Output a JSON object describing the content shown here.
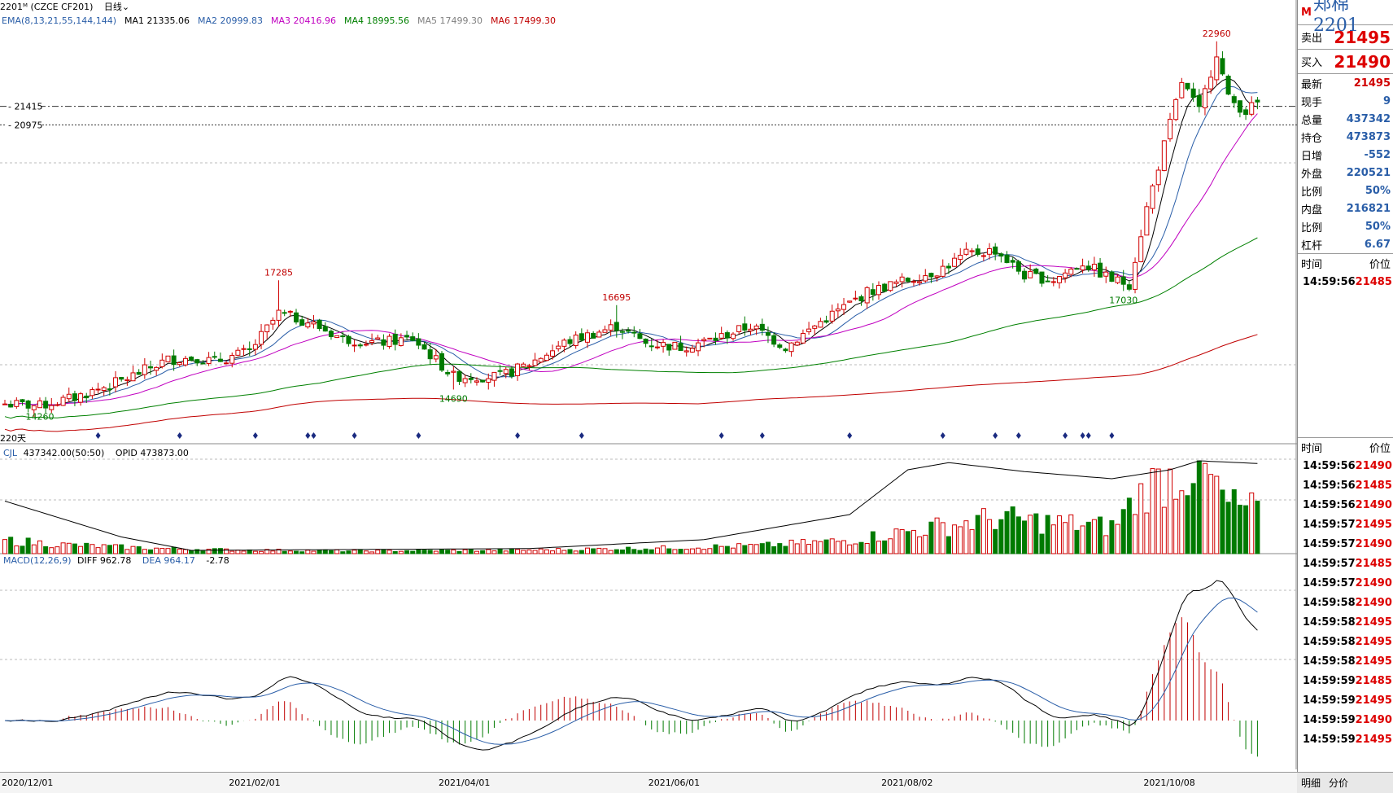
{
  "header": {
    "symbol_line": "2201ᴹ (CZCE CF201)",
    "period": "日线",
    "indicators": [
      {
        "label": "EMA(8,13,21,55,144,144)",
        "color": "#2a5ea8"
      },
      {
        "label": "MA1 21335.06",
        "color": "#000000"
      },
      {
        "label": "MA2 20999.83",
        "color": "#2a5ea8"
      },
      {
        "label": "MA3 20416.96",
        "color": "#c000c0"
      },
      {
        "label": "MA4 18995.56",
        "color": "#008000"
      },
      {
        "label": "MA5 17499.30",
        "color": "#808080"
      },
      {
        "label": "MA6 17499.30",
        "color": "#c00000"
      }
    ]
  },
  "vol_header": {
    "name": "CJL",
    "value": "437342.00(50:50)",
    "opid": "OPID 473873.00"
  },
  "macd_header": {
    "name": "MACD(12,26,9)",
    "diff": "DIFF 962.78",
    "dea": "DEA 964.17",
    "macd": "-2.78"
  },
  "days_label": "220天",
  "price_markers": [
    "21415",
    "20975"
  ],
  "chart_data": {
    "type": "candlestick",
    "ylim": [
      13500,
      23400
    ],
    "annotations": [
      {
        "label": "17285",
        "x_index": 47,
        "value": 17285,
        "kind": "high"
      },
      {
        "label": "14690",
        "x_index": 77,
        "value": 14690,
        "kind": "low"
      },
      {
        "label": "16695",
        "x_index": 105,
        "value": 16695,
        "kind": "high"
      },
      {
        "label": "14260",
        "x_index": 6,
        "value": 14260,
        "kind": "low"
      },
      {
        "label": "17030",
        "x_index": 192,
        "value": 17030,
        "kind": "low"
      },
      {
        "label": "22960",
        "x_index": 208,
        "value": 22960,
        "kind": "high"
      }
    ],
    "dates": [
      {
        "label": "2020/12/01",
        "x_index": 0
      },
      {
        "label": "2021/02/01",
        "x_index": 39
      },
      {
        "label": "2021/04/01",
        "x_index": 75
      },
      {
        "label": "2021/06/01",
        "x_index": 111
      },
      {
        "label": "2021/08/02",
        "x_index": 151
      },
      {
        "label": "2021/10/08",
        "x_index": 196
      }
    ],
    "close_anchors": [
      [
        0,
        14350
      ],
      [
        6,
        14300
      ],
      [
        12,
        14500
      ],
      [
        20,
        14900
      ],
      [
        28,
        15400
      ],
      [
        33,
        15450
      ],
      [
        36,
        15350
      ],
      [
        42,
        15600
      ],
      [
        47,
        16500
      ],
      [
        52,
        16300
      ],
      [
        58,
        15900
      ],
      [
        64,
        15800
      ],
      [
        70,
        15900
      ],
      [
        77,
        15000
      ],
      [
        85,
        15000
      ],
      [
        90,
        15300
      ],
      [
        96,
        15800
      ],
      [
        105,
        16200
      ],
      [
        110,
        15800
      ],
      [
        116,
        15700
      ],
      [
        122,
        15900
      ],
      [
        128,
        16200
      ],
      [
        134,
        15700
      ],
      [
        140,
        16300
      ],
      [
        148,
        17000
      ],
      [
        155,
        17300
      ],
      [
        160,
        17500
      ],
      [
        165,
        17900
      ],
      [
        170,
        18000
      ],
      [
        175,
        17400
      ],
      [
        180,
        17300
      ],
      [
        185,
        17700
      ],
      [
        190,
        17300
      ],
      [
        193,
        17200
      ],
      [
        196,
        19000
      ],
      [
        199,
        20500
      ],
      [
        202,
        22000
      ],
      [
        205,
        21300
      ],
      [
        208,
        22700
      ],
      [
        210,
        21600
      ],
      [
        213,
        21300
      ],
      [
        215,
        21495
      ]
    ],
    "volume_anchors": [
      [
        0,
        30000
      ],
      [
        10,
        20000
      ],
      [
        25,
        12000
      ],
      [
        40,
        8000
      ],
      [
        60,
        6000
      ],
      [
        90,
        8000
      ],
      [
        110,
        12000
      ],
      [
        130,
        18000
      ],
      [
        145,
        30000
      ],
      [
        160,
        60000
      ],
      [
        170,
        80000
      ],
      [
        180,
        70000
      ],
      [
        190,
        60000
      ],
      [
        196,
        150000
      ],
      [
        205,
        200000
      ],
      [
        210,
        110000
      ],
      [
        215,
        100000
      ]
    ],
    "vol_max": 210000,
    "oi_anchors": [
      [
        0,
        0.55
      ],
      [
        10,
        0.35
      ],
      [
        20,
        0.15
      ],
      [
        32,
        0.0
      ],
      [
        90,
        0.02
      ],
      [
        120,
        0.12
      ],
      [
        145,
        0.4
      ],
      [
        155,
        0.9
      ],
      [
        162,
        0.98
      ],
      [
        175,
        0.88
      ],
      [
        190,
        0.8
      ],
      [
        200,
        0.9
      ],
      [
        205,
        1.0
      ],
      [
        215,
        0.97
      ]
    ],
    "n": 216,
    "ma_colors": {
      "ma1": "#000000",
      "ma2": "#2a5ea8",
      "ma3": "#c000c0",
      "ma4": "#008000",
      "ma6": "#c00000"
    },
    "up_color": "#d00000",
    "down_color": "#007a00"
  },
  "side": {
    "badge": "M",
    "name": "郑棉2201",
    "sell_label": "卖出",
    "sell_value": "21495",
    "buy_label": "买入",
    "buy_value": "21490",
    "rows": [
      {
        "label": "最新",
        "value": "21495",
        "color": "#d00000"
      },
      {
        "label": "现手",
        "value": "9",
        "color": "#2a5ea8"
      },
      {
        "label": "总量",
        "value": "437342",
        "color": "#2a5ea8"
      },
      {
        "label": "持仓",
        "value": "473873",
        "color": "#2a5ea8"
      },
      {
        "label": "日增",
        "value": "-552",
        "color": "#2a5ea8"
      },
      {
        "label": "外盘",
        "value": "220521",
        "color": "#2a5ea8"
      },
      {
        "label": "比例",
        "value": "50%",
        "color": "#2a5ea8"
      },
      {
        "label": "内盘",
        "value": "216821",
        "color": "#2a5ea8"
      },
      {
        "label": "比例",
        "value": "50%",
        "color": "#2a5ea8"
      },
      {
        "label": "杠杆",
        "value": "6.67",
        "color": "#2a5ea8"
      }
    ],
    "ticks_head": {
      "time": "时间",
      "price": "价位"
    },
    "ticks_top": [
      {
        "time": "14:59:56",
        "price": "21485"
      }
    ],
    "ticks_head2": {
      "time": "时间",
      "price": "价位"
    },
    "ticks": [
      {
        "time": "14:59:56",
        "price": "21490"
      },
      {
        "time": "14:59:56",
        "price": "21485"
      },
      {
        "time": "14:59:56",
        "price": "21490"
      },
      {
        "time": "14:59:57",
        "price": "21495"
      },
      {
        "time": "14:59:57",
        "price": "21490"
      },
      {
        "time": "14:59:57",
        "price": "21485"
      },
      {
        "time": "14:59:57",
        "price": "21490"
      },
      {
        "time": "14:59:58",
        "price": "21490"
      },
      {
        "time": "14:59:58",
        "price": "21495"
      },
      {
        "time": "14:59:58",
        "price": "21495"
      },
      {
        "time": "14:59:58",
        "price": "21495"
      },
      {
        "time": "14:59:59",
        "price": "21485"
      },
      {
        "time": "14:59:59",
        "price": "21495"
      },
      {
        "time": "14:59:59",
        "price": "21490"
      },
      {
        "time": "14:59:59",
        "price": "21495"
      }
    ],
    "tabs": [
      "明细",
      "分价"
    ]
  }
}
